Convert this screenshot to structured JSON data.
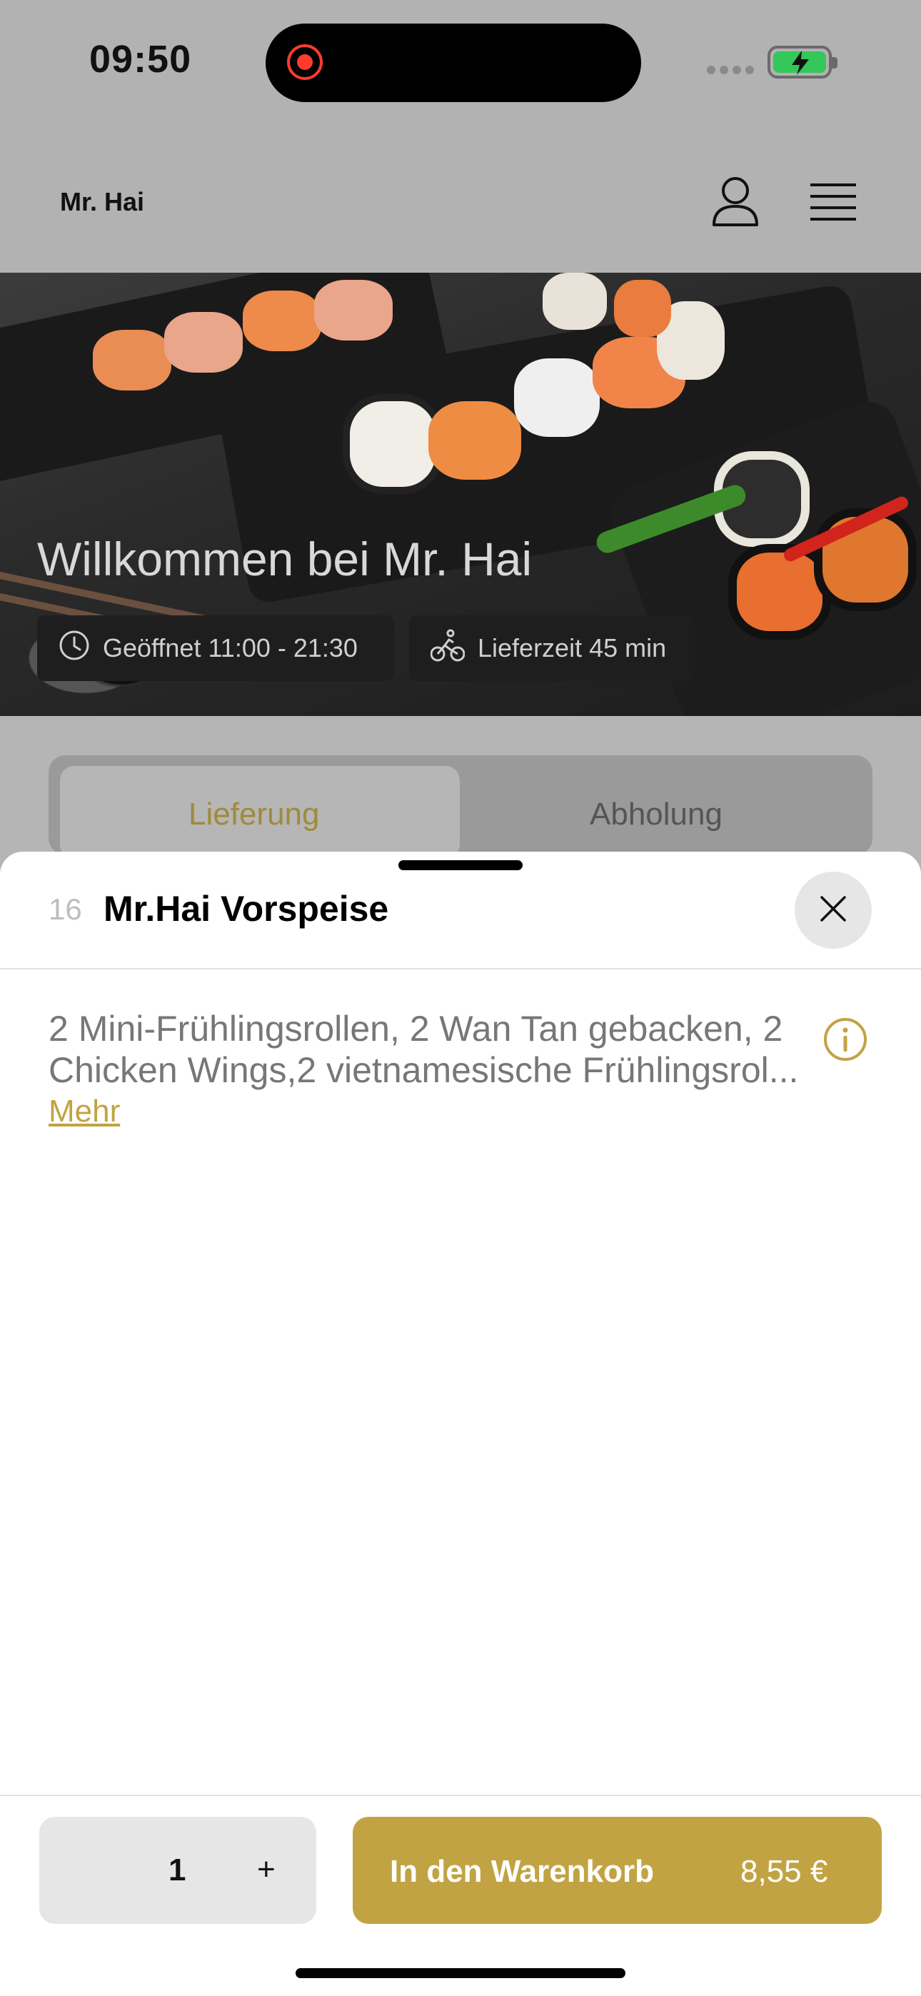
{
  "status_bar": {
    "time": "09:50"
  },
  "header": {
    "brand": "Mr. Hai"
  },
  "hero": {
    "title": "Willkommen bei Mr. Hai",
    "open_hours": "Geöffnet 11:00 - 21:30",
    "delivery_time": "Lieferzeit 45 min"
  },
  "tabs": {
    "delivery": "Lieferung",
    "pickup": "Abholung",
    "active": "Lieferung"
  },
  "item": {
    "number": "16",
    "title": "Mr.Hai Vorspeise",
    "description_line1": "2 Mini-Frühlingsrollen, 2 Wan Tan gebacken, 2",
    "description_line2": "Chicken Wings,2 vietnamesische Frühlingsrol...",
    "more_label": "Mehr"
  },
  "footer": {
    "quantity": "1",
    "plus_label": "+",
    "add_to_cart_label": "In den Warenkorb",
    "price": "8,55 €"
  },
  "colors": {
    "accent": "#c2a343",
    "overlay": "#b2b2b2",
    "battery": "#34c759"
  }
}
